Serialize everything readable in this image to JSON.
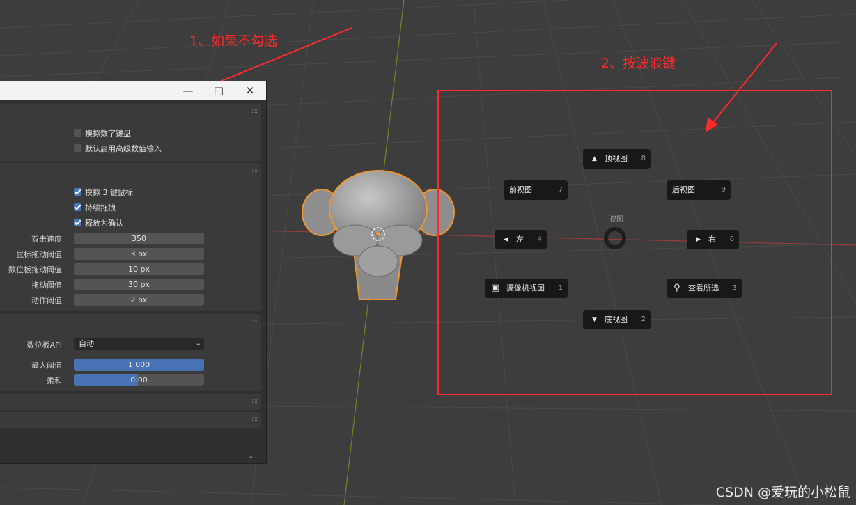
{
  "annotations": {
    "note1": "1、如果不勾选",
    "note2": "2、按波浪键"
  },
  "window": {
    "minimize_icon": "minimize-icon",
    "maximize_icon": "maximize-icon",
    "close_icon": "close-icon"
  },
  "keyboard_panel": {
    "emulate_numpad": {
      "label": "模拟数字键盘",
      "checked": false
    },
    "default_adv_input": {
      "label": "默认启用高级数值输入",
      "checked": false
    }
  },
  "mouse_panel": {
    "emulate_3_button": {
      "label": "模拟 3 键鼠标",
      "checked": true
    },
    "continuous_grab": {
      "label": "持续拖拽",
      "checked": true
    },
    "release_confirm": {
      "label": "释放为确认",
      "checked": true
    },
    "fields": [
      {
        "label": "双击速度",
        "value": "350"
      },
      {
        "label": "鼠标拖动阈值",
        "value": "3 px"
      },
      {
        "label": "数位板拖动阈值",
        "value": "10 px"
      },
      {
        "label": "拖动阈值",
        "value": "30 px"
      },
      {
        "label": "动作阈值",
        "value": "2 px"
      }
    ]
  },
  "tablet_panel": {
    "api_label": "数位板API",
    "api_value": "自动",
    "max_threshold": {
      "label": "最大阈值",
      "value": "1.000",
      "fraction": 1.0
    },
    "softness": {
      "label": "柔和",
      "value": "0.00",
      "fraction": 0.49
    }
  },
  "pie_menu": {
    "title": "视图",
    "items": {
      "top": {
        "label": "顶视图",
        "key": "8"
      },
      "front": {
        "label": "前视图",
        "key": "7"
      },
      "back": {
        "label": "后视图",
        "key": "9"
      },
      "left": {
        "label": "左",
        "key": "4"
      },
      "right": {
        "label": "右",
        "key": "6"
      },
      "camera": {
        "label": "摄像机视图",
        "key": "1"
      },
      "selected": {
        "label": "查看所选",
        "key": "3"
      },
      "bottom": {
        "label": "底视图",
        "key": "2"
      }
    }
  },
  "watermark": "CSDN @爱玩的小松鼠",
  "colors": {
    "viewport_bg": "#3d3d3d",
    "accent_blue": "#4772b3",
    "annotation_red": "#ff2a2a",
    "object_outline": "#f0962e"
  }
}
